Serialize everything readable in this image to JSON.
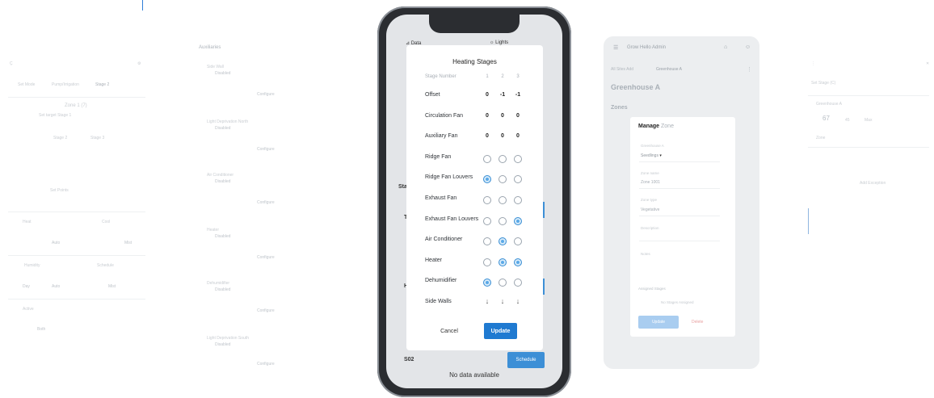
{
  "left_pane": {
    "top_left": "Ç",
    "tabs": [
      "Set Mode",
      "Pump/Irrigation",
      "Stage 2"
    ],
    "zone_title": "Zone 1 (7)",
    "zone_sub": "Set target Stage 1",
    "texts": [
      "Stage 2",
      "Stage 3",
      "Set Points",
      "Heat",
      "Cool",
      "Humidity",
      "Schedule",
      "Active"
    ],
    "small_vals": [
      "Auto",
      "Mist",
      "Day",
      "Auto",
      "Mist",
      "Both"
    ]
  },
  "actuators": {
    "title": "Auxiliaries",
    "items": [
      {
        "name": "Side Wall",
        "status": "Disabled",
        "action": "Configure"
      },
      {
        "name": "Light Deprivation North",
        "status": "Disabled",
        "action": "Configure"
      },
      {
        "name": "Air Conditioner",
        "status": "Disabled",
        "action": "Configure"
      },
      {
        "name": "Heater",
        "status": "Disabled",
        "action": "Configure"
      },
      {
        "name": "Dehumidifier",
        "status": "Disabled",
        "action": "Configure"
      },
      {
        "name": "Light Deprivation South",
        "status": "Disabled",
        "action": "Configure"
      }
    ]
  },
  "phone": {
    "top_left_label": "Data",
    "top_right_label": "Lights",
    "bg_letter_1": "Sta",
    "bg_letter_2": "T",
    "bg_letter_3": "H",
    "bottom_code": "S02",
    "bottom_button": "Schedule",
    "no_data": "No data available",
    "modal": {
      "title": "Heating Stages",
      "stage_label": "Stage Number",
      "stage_numbers": [
        "1",
        "2",
        "3"
      ],
      "rows": [
        {
          "label": "Offset",
          "type": "num",
          "values": [
            "0",
            "-1",
            "-1"
          ]
        },
        {
          "label": "Circulation Fan",
          "type": "num",
          "values": [
            "0",
            "0",
            "0"
          ]
        },
        {
          "label": "Auxiliary Fan",
          "type": "num",
          "values": [
            "0",
            "0",
            "0"
          ]
        },
        {
          "label": "Ridge Fan",
          "type": "radio",
          "values": [
            0,
            0,
            0
          ]
        },
        {
          "label": "Ridge Fan Louvers",
          "type": "radio",
          "values": [
            1,
            0,
            0
          ]
        },
        {
          "label": "Exhaust Fan",
          "type": "radio",
          "values": [
            0,
            0,
            0
          ]
        },
        {
          "label": "Exhaust Fan Louvers",
          "type": "radio",
          "values": [
            0,
            0,
            1
          ]
        },
        {
          "label": "Air Conditioner",
          "type": "radio",
          "values": [
            0,
            1,
            0
          ]
        },
        {
          "label": "Heater",
          "type": "radio",
          "values": [
            0,
            1,
            1
          ]
        },
        {
          "label": "Dehumidifier",
          "type": "radio",
          "values": [
            1,
            0,
            0
          ]
        },
        {
          "label": "Side Walls",
          "type": "arrow",
          "values": [
            "↓",
            "↓",
            "↓"
          ]
        }
      ],
      "cancel": "Cancel",
      "update": "Update"
    }
  },
  "tablet": {
    "header_title": "Grow Hello Admin",
    "breadcrumb_1": "All Sites Add",
    "breadcrumb_2": "Greenhouse A",
    "page_title": "Greenhouse A",
    "section": "Zones",
    "card": {
      "title_bold": "Manage",
      "title_rest": "Zone",
      "field1_label": "Greenhouse A",
      "field1_value": "Seedlings",
      "field2_label": "Zone name",
      "field2_value": "Zone 1001",
      "field3_label": "Zone type",
      "field3_value": "Vegetative",
      "field4_label": "Description",
      "field5_label": "Notes",
      "assigned_label": "Assigned Stages",
      "assigned_value": "No Stages Assigned",
      "update": "Update",
      "delete": "Delete"
    }
  },
  "right_pane": {
    "header": "Set Stage (C)",
    "label1": "Greenhouse A",
    "value1": "67",
    "value1b": "45",
    "value1c": "Max",
    "label2": "Zone",
    "link": "Add Exception"
  }
}
